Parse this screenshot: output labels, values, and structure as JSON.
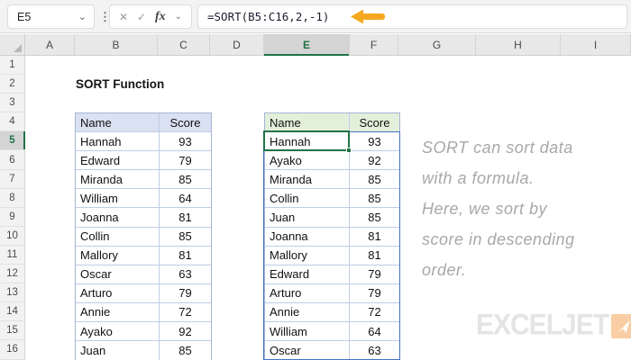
{
  "formula_bar": {
    "name_box_value": "E5",
    "cancel_label": "✕",
    "enter_label": "✓",
    "fx_label": "fx",
    "formula": "=SORT(B5:C16,2,-1)"
  },
  "grid": {
    "column_labels": [
      "A",
      "B",
      "C",
      "D",
      "E",
      "F",
      "G",
      "H",
      "I"
    ],
    "selected_column": "E",
    "row_labels": [
      "1",
      "2",
      "3",
      "4",
      "5",
      "6",
      "7",
      "8",
      "9",
      "10",
      "11",
      "12",
      "13",
      "14",
      "15",
      "16"
    ],
    "selected_row": "5"
  },
  "content": {
    "title": "SORT Function",
    "annotation": "SORT can sort data\nwith a formula.\nHere, we sort by\nscore in descending\norder.",
    "logo_text": "EXCELJET",
    "logo_icon": "paper-plane-icon"
  },
  "left_table": {
    "headers": [
      "Name",
      "Score"
    ],
    "rows": [
      [
        "Hannah",
        "93"
      ],
      [
        "Edward",
        "79"
      ],
      [
        "Miranda",
        "85"
      ],
      [
        "William",
        "64"
      ],
      [
        "Joanna",
        "81"
      ],
      [
        "Collin",
        "85"
      ],
      [
        "Mallory",
        "81"
      ],
      [
        "Oscar",
        "63"
      ],
      [
        "Arturo",
        "79"
      ],
      [
        "Annie",
        "72"
      ],
      [
        "Ayako",
        "92"
      ],
      [
        "Juan",
        "85"
      ]
    ]
  },
  "right_table": {
    "headers": [
      "Name",
      "Score"
    ],
    "rows": [
      [
        "Hannah",
        "93"
      ],
      [
        "Ayako",
        "92"
      ],
      [
        "Miranda",
        "85"
      ],
      [
        "Collin",
        "85"
      ],
      [
        "Juan",
        "85"
      ],
      [
        "Joanna",
        "81"
      ],
      [
        "Mallory",
        "81"
      ],
      [
        "Edward",
        "79"
      ],
      [
        "Arturo",
        "79"
      ],
      [
        "Annie",
        "72"
      ],
      [
        "William",
        "64"
      ],
      [
        "Oscar",
        "63"
      ]
    ]
  },
  "colors": {
    "accent_green": "#217346",
    "spill_blue": "#4472c4",
    "left_header_fill": "#d9e1f2",
    "right_header_fill": "#e2efda",
    "arrow_orange": "#f5a81f",
    "annotation_gray": "#a8a8a8",
    "logo_gray": "#e4e4e4",
    "logo_orange": "#f9cea4"
  }
}
